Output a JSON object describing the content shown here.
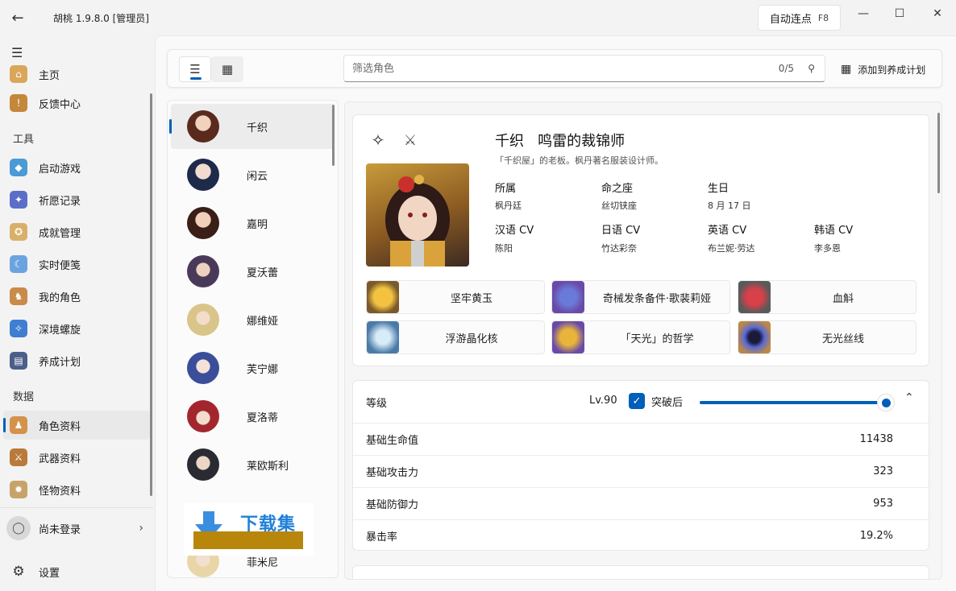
{
  "window": {
    "title": "胡桃 1.9.8.0 [管理员]",
    "back_icon": "←",
    "autoclick_label": "自动连点",
    "autoclick_key": "F8",
    "minimize": "—",
    "maximize": "☐",
    "close": "✕"
  },
  "nav": {
    "items": [
      {
        "label": "主页",
        "icon": "home-icon"
      },
      {
        "label": "反馈中心",
        "icon": "feedback-icon"
      },
      {
        "label": "启动游戏",
        "icon": "launch-icon"
      },
      {
        "label": "祈愿记录",
        "icon": "wish-icon"
      },
      {
        "label": "成就管理",
        "icon": "achievement-icon"
      },
      {
        "label": "实时便笺",
        "icon": "notes-icon"
      },
      {
        "label": "我的角色",
        "icon": "my-character-icon"
      },
      {
        "label": "深境螺旋",
        "icon": "abyss-icon"
      },
      {
        "label": "养成计划",
        "icon": "plan-icon"
      },
      {
        "label": "角色资料",
        "icon": "character-wiki-icon"
      },
      {
        "label": "武器资料",
        "icon": "weapon-wiki-icon"
      },
      {
        "label": "怪物资料",
        "icon": "monster-wiki-icon"
      }
    ],
    "section_tools": "工具",
    "section_data": "数据",
    "login_label": "尚未登录",
    "settings_label": "设置"
  },
  "toolbar": {
    "search_placeholder": "筛选角色",
    "search_count": "0/5",
    "add_plan_label": "添加到养成计划"
  },
  "characters": [
    {
      "name": "千织",
      "selected": true
    },
    {
      "name": "闲云",
      "selected": false
    },
    {
      "name": "嘉明",
      "selected": false
    },
    {
      "name": "夏沃蕾",
      "selected": false
    },
    {
      "name": "娜维娅",
      "selected": false
    },
    {
      "name": "芙宁娜",
      "selected": false
    },
    {
      "name": "夏洛蒂",
      "selected": false
    },
    {
      "name": "莱欧斯利",
      "selected": false
    },
    {
      "name": "菲米尼",
      "selected": false
    }
  ],
  "detail": {
    "name": "千织",
    "title": "鸣雷的裁锦师",
    "description": "「千织屋」的老板。枫丹著名服装设计师。",
    "info": [
      {
        "label": "所属",
        "value": "枫丹廷"
      },
      {
        "label": "命之座",
        "value": "丝切铗座"
      },
      {
        "label": "生日",
        "value": "8 月 17 日"
      },
      {
        "label": "汉语 CV",
        "value": "陈阳"
      },
      {
        "label": "日语 CV",
        "value": "竹达彩奈"
      },
      {
        "label": "英语 CV",
        "value": "布兰妮·劳达"
      },
      {
        "label": "韩语 CV",
        "value": "李多恩"
      }
    ],
    "materials": [
      {
        "name": "坚牢黄玉",
        "color": "#d9a22a"
      },
      {
        "name": "奇械发条备件·歌裴莉娅",
        "color": "#7a5fc2"
      },
      {
        "name": "血斛",
        "color": "#c43a4a"
      },
      {
        "name": "浮游晶化核",
        "color": "#5f88b8"
      },
      {
        "name": "「天光」的哲学",
        "color": "#c89b3a"
      },
      {
        "name": "无光丝线",
        "color": "#3a3f9a"
      }
    ]
  },
  "level": {
    "label": "等级",
    "value": "Lv.90",
    "ascended_label": "突破后",
    "ascended": true,
    "slider_fraction": 1.0
  },
  "stats": [
    {
      "label": "基础生命值",
      "value": "11438"
    },
    {
      "label": "基础攻击力",
      "value": "323"
    },
    {
      "label": "基础防御力",
      "value": "953"
    },
    {
      "label": "暴击率",
      "value": "19.2%"
    }
  ],
  "watermark": {
    "text": "下载集"
  },
  "colors": {
    "accent": "#005fb8"
  }
}
